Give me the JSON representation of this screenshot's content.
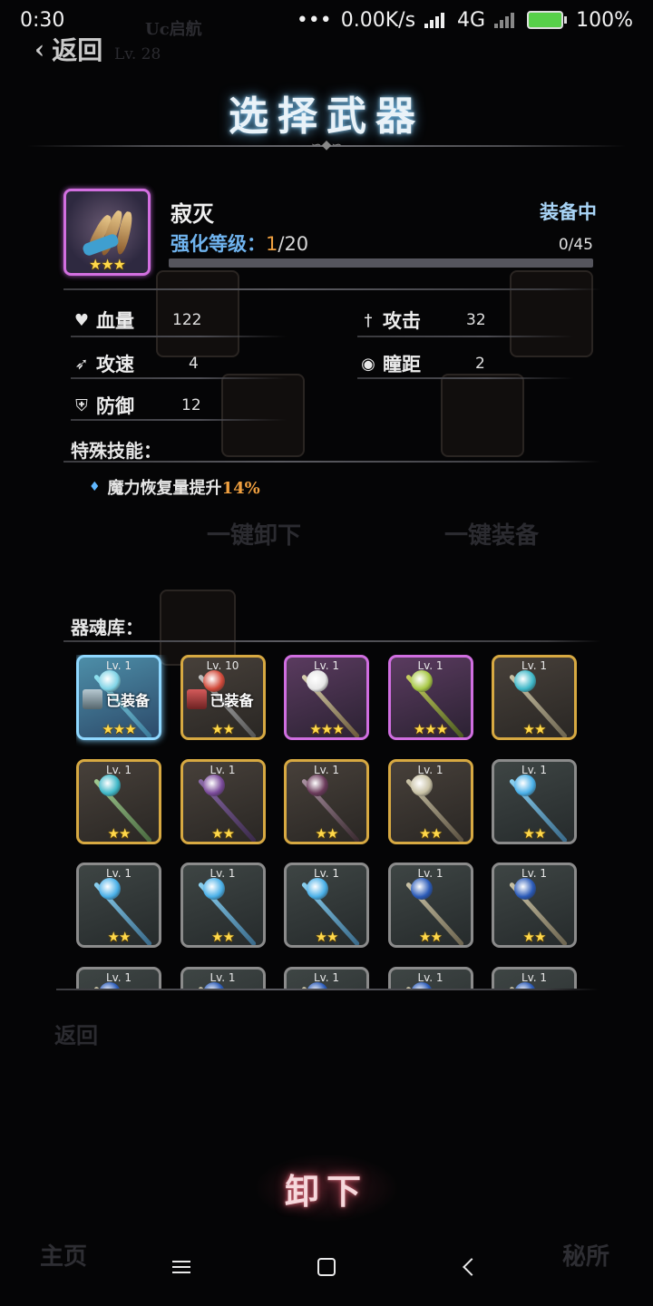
{
  "status_bar": {
    "time": "0:30",
    "network_speed": "0.00K/s",
    "network_type": "4G",
    "battery": "100%"
  },
  "header": {
    "back_label": "返回",
    "title": "选择武器"
  },
  "weapon": {
    "name": "寂灭",
    "upgrade_label": "强化等级：",
    "upgrade_current": "1",
    "upgrade_max": "/20",
    "status": "装备中",
    "exp_text": "0/45",
    "exp_fraction": 0,
    "stars": "★★★",
    "stats": {
      "hp_label": "血量",
      "hp_value": "122",
      "atk_label": "攻击",
      "atk_value": "32",
      "spd_label": "攻速",
      "spd_value": "4",
      "range_label": "瞳距",
      "range_value": "2",
      "def_label": "防御",
      "def_value": "12"
    },
    "skill_title": "特殊技能：",
    "skill_text": "魔力恢复量提升",
    "skill_pct": "14%"
  },
  "library": {
    "title": "器魂库：",
    "items": [
      {
        "lv": "Lv. 1",
        "stars": "★★★",
        "badge": "已装备"
      },
      {
        "lv": "Lv. 10",
        "stars": "★★",
        "badge": "已装备"
      },
      {
        "lv": "Lv. 1",
        "stars": "★★★"
      },
      {
        "lv": "Lv. 1",
        "stars": "★★★"
      },
      {
        "lv": "Lv. 1",
        "stars": "★★"
      },
      {
        "lv": "Lv. 1",
        "stars": "★★"
      },
      {
        "lv": "Lv. 1",
        "stars": "★★"
      },
      {
        "lv": "Lv. 1",
        "stars": "★★"
      },
      {
        "lv": "Lv. 1",
        "stars": "★★"
      },
      {
        "lv": "Lv. 1",
        "stars": "★★"
      },
      {
        "lv": "Lv. 1",
        "stars": "★★"
      },
      {
        "lv": "Lv. 1",
        "stars": "★★"
      },
      {
        "lv": "Lv. 1",
        "stars": "★★"
      },
      {
        "lv": "Lv. 1",
        "stars": "★★"
      },
      {
        "lv": "Lv. 1",
        "stars": "★★"
      },
      {
        "lv": "Lv. 1",
        "stars": ""
      },
      {
        "lv": "Lv. 1",
        "stars": ""
      },
      {
        "lv": "Lv. 1",
        "stars": ""
      },
      {
        "lv": "Lv. 1",
        "stars": ""
      },
      {
        "lv": "Lv. 1",
        "stars": ""
      }
    ]
  },
  "actions": {
    "unequip_label": "卸下"
  },
  "background_text": {
    "top_tab": "Uc启航",
    "top_level": "Lv. 28",
    "unequip_all": "一键卸下",
    "equip_all": "一键装备",
    "back": "返回",
    "nav_home": "主页",
    "nav_secret": "秘所"
  },
  "colors": {
    "title_glow": "#5fa8d8",
    "upgrade_blue": "#6fb3ee",
    "accent_orange": "#f0a040",
    "star_gold": "#ffd84a",
    "unequip_glow": "#c0485a"
  }
}
